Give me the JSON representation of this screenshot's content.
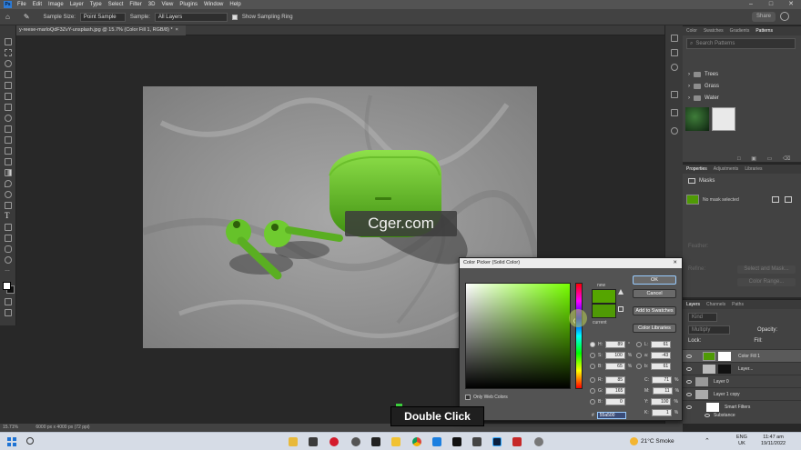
{
  "menu": {
    "logo": "Ps",
    "items": [
      "File",
      "Edit",
      "Image",
      "Layer",
      "Type",
      "Select",
      "Filter",
      "3D",
      "View",
      "Plugins",
      "Window",
      "Help"
    ]
  },
  "options_bar": {
    "sample_size_label": "Sample Size:",
    "sample_size_value": "Point Sample",
    "sample_label": "Sample:",
    "sample_value": "All Layers",
    "show_ring_label": "Show Sampling Ring",
    "share_label": "Share"
  },
  "document_tab": "y-reese-marloQdF3ZvY-unsplash.jpg @ 15.7% (Color Fill 1, RGB/8) *",
  "status": {
    "zoom": "15.71%",
    "doc_size": "6000 px x 4000 px (72 ppi)"
  },
  "watermark": "Cger.com",
  "overlay_caption": "Double Click",
  "patterns_panel": {
    "tabs": [
      "Color",
      "Swatches",
      "Gradients",
      "Patterns"
    ],
    "active_tab": "Patterns",
    "search_placeholder": "Search Patterns",
    "folders": [
      "Trees",
      "Grass",
      "Water"
    ]
  },
  "properties_panel": {
    "tabs": [
      "Properties",
      "Adjustments",
      "Libraries"
    ],
    "section": "Masks",
    "mask_status": "No mask selected",
    "feather_label": "Feather:",
    "refine_label": "Refine:",
    "select_mask_label": "Select and Mask...",
    "color_range_label": "Color Range..."
  },
  "layers_panel": {
    "tabs": [
      "Layers",
      "Channels",
      "Paths"
    ],
    "kind_label": "Kind",
    "blend_mode": "Multiply",
    "opacity_label": "Opacity:",
    "lock_label": "Lock:",
    "fill_label": "Fill:",
    "layers": [
      "Color Fill 1",
      "Layer...",
      "Layer 0",
      "Layer 1 copy",
      "Smart Filters",
      "Substance"
    ]
  },
  "color_picker": {
    "title": "Color Picker (Solid Color)",
    "ok": "OK",
    "cancel": "Cancel",
    "add_to_swatches": "Add to Swatches",
    "color_libraries": "Color Libraries",
    "new_label": "new",
    "current_label": "current",
    "only_web_colors": "Only Web Colors",
    "hsb": [
      {
        "label": "H:",
        "value": "89",
        "unit": "°"
      },
      {
        "label": "S:",
        "value": "100",
        "unit": "%"
      },
      {
        "label": "B:",
        "value": "65",
        "unit": "%"
      }
    ],
    "rgb": [
      {
        "label": "R:",
        "value": "85"
      },
      {
        "label": "G:",
        "value": "165"
      },
      {
        "label": "B:",
        "value": "0"
      }
    ],
    "lab": [
      {
        "label": "L:",
        "value": "61"
      },
      {
        "label": "a:",
        "value": "-43"
      },
      {
        "label": "b:",
        "value": "61"
      }
    ],
    "cmyk": [
      {
        "label": "C:",
        "value": "71",
        "unit": "%"
      },
      {
        "label": "M:",
        "value": "11",
        "unit": "%"
      },
      {
        "label": "Y:",
        "value": "100",
        "unit": "%"
      },
      {
        "label": "K:",
        "value": "1",
        "unit": "%"
      }
    ],
    "hex_label": "#",
    "hex": "55a500",
    "new_color": "#55a500",
    "current_color": "#4f9a05"
  },
  "taskbar": {
    "weather": "21°C  Smoke",
    "lang_1": "ENG",
    "lang_2": "UK",
    "time": "11:47 am",
    "date": "19/11/2022"
  },
  "colors": {
    "accent_green": "#55a500",
    "ps_blue": "#2d7bd6"
  }
}
